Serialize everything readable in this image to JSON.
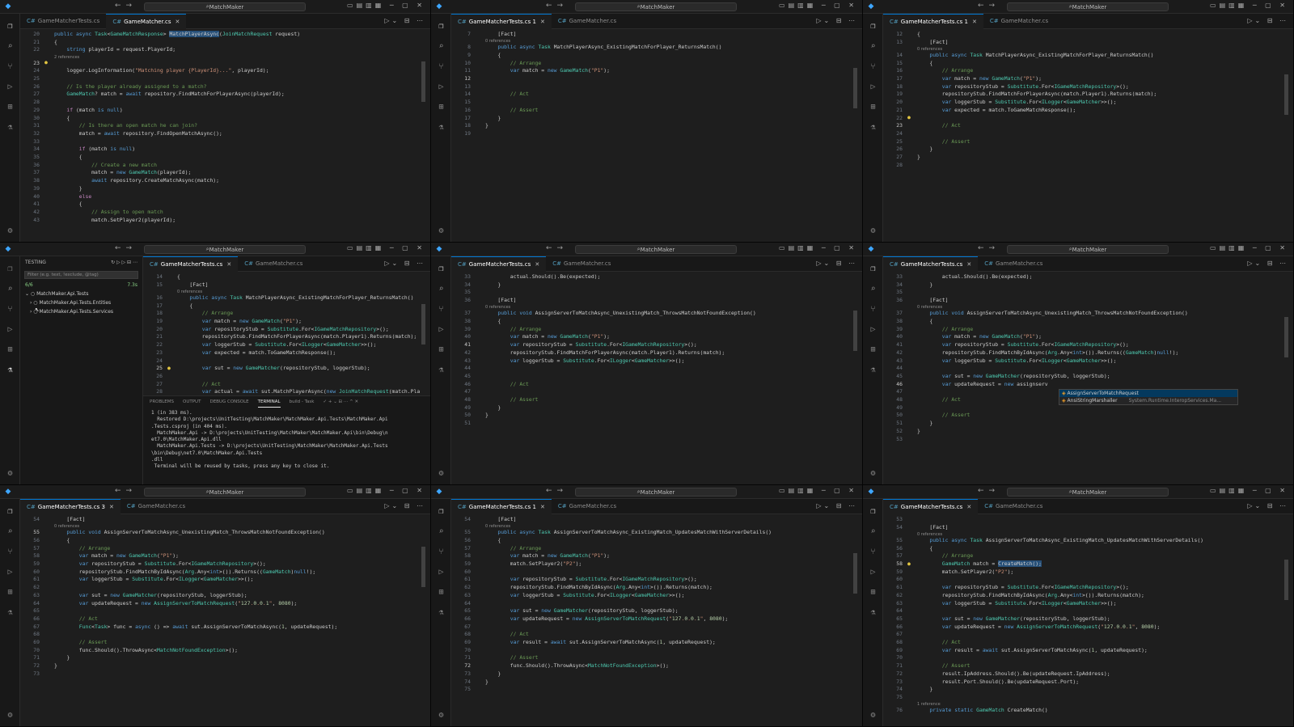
{
  "window": {
    "search": "MatchMaker"
  },
  "tabs": {
    "tests": "GameMatcherTests.cs",
    "tests_dirty3": "GameMatcherTests.cs 3",
    "tests_dirty1": "GameMatcherTests.cs 1",
    "source": "GameMatcher.cs"
  },
  "lens": {
    "refs2": "2 references",
    "refs0": "0 references",
    "refs1": "1 reference"
  },
  "testing": {
    "title": "TESTING",
    "filter": "Filter (e.g. text, !exclude, @tag)",
    "status": "6/6",
    "duration": "7.3s",
    "items": [
      "MatchMaker.Api.Tests",
      "MatchMaker.Api.Tests.Entities",
      "MatchMaker.Api.Tests.Services"
    ]
  },
  "panel": {
    "tabs": [
      "PROBLEMS",
      "OUTPUT",
      "DEBUG CONSOLE",
      "TERMINAL"
    ],
    "task": "build - Task",
    "lines": [
      "1 (in 383 ms).",
      "  Restored D:\\projects\\UnitTesting\\MatchMaker\\MatchMaker.Api.Tests\\MatchMaker.Api",
      ".Tests.csproj (in 404 ms).",
      "  MatchMaker.Api -> D:\\projects\\UnitTesting\\MatchMaker\\MatchMaker.Api\\bin\\Debug\\n",
      "et7.0\\MatchMaker.Api.dll",
      "  MatchMaker.Api.Tests -> D:\\projects\\UnitTesting\\MatchMaker\\MatchMaker.Api.Tests",
      "\\bin\\Debug\\net7.0\\MatchMaker.Api.Tests",
      ".dll",
      " Terminal will be reused by tasks, press any key to close it."
    ]
  },
  "suggest": [
    {
      "label": "AssignServerToMatchRequest",
      "detail": ""
    },
    {
      "label": "AnsiStringMarshaller",
      "detail": "System.Runtime.InteropServices.Ma..."
    }
  ],
  "p1": {
    "lines": [
      "public async Task<GameMatchResponse> MatchPlayerAsync(JoinMatchRequest request)",
      "{",
      "    string playerId = request.PlayerId;",
      "",
      "    logger.LogInformation(\"Matching player {PlayerId}...\", playerId);",
      "",
      "    // Is the player already assigned to a match?",
      "    GameMatch? match = await repository.FindMatchForPlayerAsync(playerId);",
      "",
      "    if (match is null)",
      "    {",
      "        // Is there an open match he can join?",
      "        match = await repository.FindOpenMatchAsync();",
      "",
      "        if (match is null)",
      "        {",
      "            // Create a new match",
      "            match = new GameMatch(playerId);",
      "            await repository.CreateMatchAsync(match);",
      "        }",
      "        else",
      "        {",
      "            // Assign to open match",
      "            match.SetPlayer2(playerId);"
    ]
  },
  "p2": {
    "lines": [
      "    [Fact]",
      "    public async Task MatchPlayerAsync_ExistingMatchForPlayer_ReturnsMatch()",
      "    {",
      "        // Arrange",
      "        var match = new GameMatch(\"P1\");",
      "",
      "",
      "        // Act",
      "",
      "        // Assert",
      "    }",
      "}",
      ""
    ]
  },
  "p3": {
    "lines": [
      "{",
      "    [Fact]",
      "    public async Task MatchPlayerAsync_ExistingMatchForPlayer_ReturnsMatch()",
      "    {",
      "        // Arrange",
      "        var match = new GameMatch(\"P1\");",
      "        var repositoryStub = Substitute.For<IGameMatchRepository>();",
      "        repositoryStub.FindMatchForPlayerAsync(match.Player1).Returns(match);",
      "        var loggerStub = Substitute.For<ILogger<GameMatcher>>();",
      "        var expected = match.ToGameMatchResponse();",
      "",
      "        // Act",
      "",
      "        // Assert",
      "    }",
      "}",
      ""
    ]
  },
  "p4": {
    "lines": [
      "{",
      "    [Fact]",
      "    public async Task MatchPlayerAsync_ExistingMatchForPlayer_ReturnsMatch()",
      "    {",
      "        // Arrange",
      "        var match = new GameMatch(\"P1\");",
      "        var repositoryStub = Substitute.For<IGameMatchRepository>();",
      "        repositoryStub.FindMatchForPlayerAsync(match.Player1).Returns(match);",
      "        var loggerStub = Substitute.For<ILogger<GameMatcher>>();",
      "        var expected = match.ToGameMatchResponse();",
      "",
      "        var sut = new GameMatcher(repositoryStub, loggerStub);",
      "",
      "        // Act",
      "        var actual = await sut.MatchPlayerAsync(new JoinMatchRequest(match.Pla"
    ]
  },
  "p5": {
    "lines": [
      "        actual.Should().Be(expected);",
      "    }",
      "",
      "    [Fact]",
      "    public void AssignServerToMatchAsync_UnexistingMatch_ThrowsMatchNotFoundException()",
      "    {",
      "        // Arrange",
      "        var match = new GameMatch(\"P1\");",
      "        var repositoryStub = Substitute.For<IGameMatchRepository>();",
      "        repositoryStub.FindMatchForPlayerAsync(match.Player1).Returns(match);",
      "        var loggerStub = Substitute.For<ILogger<GameMatcher>>();",
      "",
      "",
      "        // Act",
      "",
      "        // Assert",
      "    }",
      "}",
      ""
    ]
  },
  "p6": {
    "lines": [
      "        actual.Should().Be(expected);",
      "    }",
      "",
      "    [Fact]",
      "    public void AssignServerToMatchAsync_UnexistingMatch_ThrowsMatchNotFoundException()",
      "    {",
      "        // Arrange",
      "        var match = new GameMatch(\"P1\");",
      "        var repositoryStub = Substitute.For<IGameMatchRepository>();",
      "        repositoryStub.FindMatchByIdAsync(Arg.Any<int>()).Returns((GameMatch)null!);",
      "        var loggerStub = Substitute.For<ILogger<GameMatcher>>();",
      "",
      "        var sut = new GameMatcher(repositoryStub, loggerStub);",
      "        var updateRequest = new assignserv",
      "",
      "        // Act",
      "",
      "        // Assert",
      "    }",
      "}",
      ""
    ]
  },
  "p7": {
    "lines": [
      "    [Fact]",
      "    public void AssignServerToMatchAsync_UnexistingMatch_ThrowsMatchNotFoundException()",
      "    {",
      "        // Arrange",
      "        var match = new GameMatch(\"P1\");",
      "        var repositoryStub = Substitute.For<IGameMatchRepository>();",
      "        repositoryStub.FindMatchByIdAsync(Arg.Any<int>()).Returns((GameMatch)null!);",
      "        var loggerStub = Substitute.For<ILogger<GameMatcher>>();",
      "",
      "        var sut = new GameMatcher(repositoryStub, loggerStub);",
      "        var updateRequest = new AssignServerToMatchRequest(\"127.0.0.1\", 8080);",
      "",
      "        // Act",
      "        Func<Task> func = async () => await sut.AssignServerToMatchAsync(1, updateRequest);",
      "",
      "        // Assert",
      "        func.Should().ThrowAsync<MatchNotFoundException>();",
      "    }",
      "}",
      ""
    ]
  },
  "p8": {
    "lines": [
      "    [Fact]",
      "    public async Task AssignServerToMatchAsync_ExistingMatch_UpdatesMatchWithServerDetails()",
      "    {",
      "        // Arrange",
      "        var match = new GameMatch(\"P1\");",
      "        match.SetPlayer2(\"P2\");",
      "",
      "        var repositoryStub = Substitute.For<IGameMatchRepository>();",
      "        repositoryStub.FindMatchByIdAsync(Arg.Any<int>()).Returns(match);",
      "        var loggerStub = Substitute.For<ILogger<GameMatcher>>();",
      "",
      "        var sut = new GameMatcher(repositoryStub, loggerStub);",
      "        var updateRequest = new AssignServerToMatchRequest(\"127.0.0.1\", 8080);",
      "",
      "        // Act",
      "        var result = await sut.AssignServerToMatchAsync(1, updateRequest);",
      "",
      "        // Assert",
      "        func.Should().ThrowAsync<MatchNotFoundException>();",
      "    }",
      "}",
      ""
    ]
  },
  "p9": {
    "lines": [
      "",
      "    [Fact]",
      "    public async Task AssignServerToMatchAsync_ExistingMatch_UpdatesMatchWithServerDetails()",
      "    {",
      "        // Arrange",
      "        GameMatch match = CreateMatch();",
      "        match.SetPlayer2(\"P2\");",
      "",
      "        var repositoryStub = Substitute.For<IGameMatchRepository>();",
      "        repositoryStub.FindMatchByIdAsync(Arg.Any<int>()).Returns(match);",
      "        var loggerStub = Substitute.For<ILogger<GameMatcher>>();",
      "",
      "        var sut = new GameMatcher(repositoryStub, loggerStub);",
      "        var updateRequest = new AssignServerToMatchRequest(\"127.0.0.1\", 8080);",
      "",
      "        // Act",
      "        var result = await sut.AssignServerToMatchAsync(1, updateRequest);",
      "",
      "        // Assert",
      "        result.IpAddress.Should().Be(updateRequest.IpAddress);",
      "        result.Port.Should().Be(updateRequest.Port);",
      "    }",
      "",
      "    private static GameMatch CreateMatch()"
    ]
  }
}
